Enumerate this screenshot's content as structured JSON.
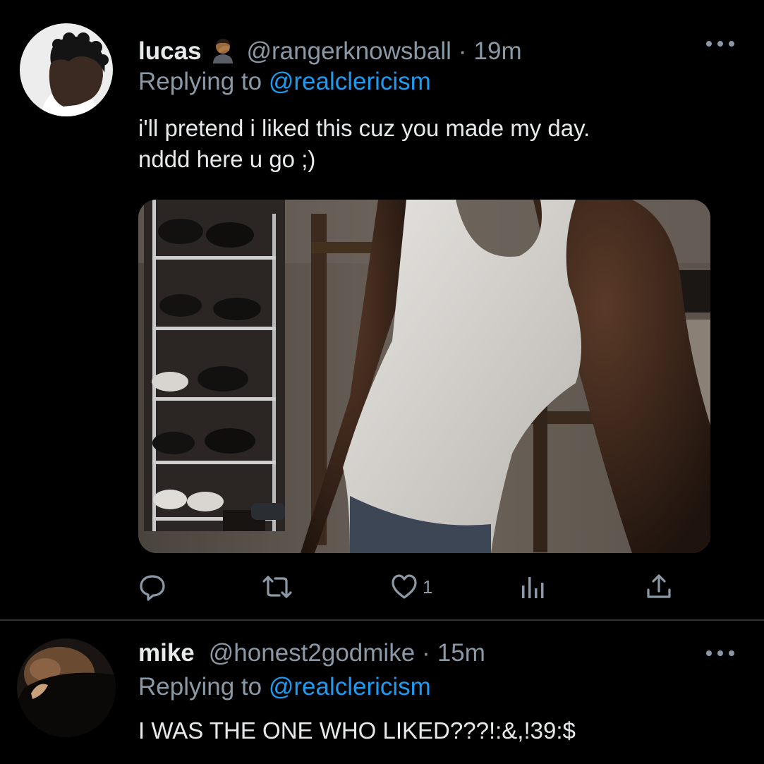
{
  "tweets": [
    {
      "display_name": "lucas",
      "handle": "@rangerknowsball",
      "separator": "·",
      "time": "19m",
      "replying_label": "Replying to",
      "replying_to": "@realclericism",
      "text_lines": [
        "i'll pretend i liked this cuz you made my day.",
        "nddd here u go ;)"
      ],
      "actions": {
        "reply_count": "",
        "retweet_count": "",
        "like_count": "1"
      }
    },
    {
      "display_name": "mike",
      "handle": "@honest2godmike",
      "separator": "·",
      "time": "15m",
      "replying_label": "Replying to",
      "replying_to": "@realclericism",
      "text_lines": [
        "I WAS THE ONE WHO LIKED???!:&,!39:$"
      ]
    }
  ],
  "icons": {
    "name_emoji": "man-facepalming-emoji",
    "more": "more-dots-icon",
    "reply": "reply-icon",
    "retweet": "retweet-icon",
    "like": "heart-icon",
    "analytics": "analytics-icon",
    "share": "share-icon"
  },
  "colors": {
    "background": "#000000",
    "text": "#e7e9ea",
    "muted": "#8b98a5",
    "link": "#1d9bf0",
    "divider": "#2f3336"
  }
}
